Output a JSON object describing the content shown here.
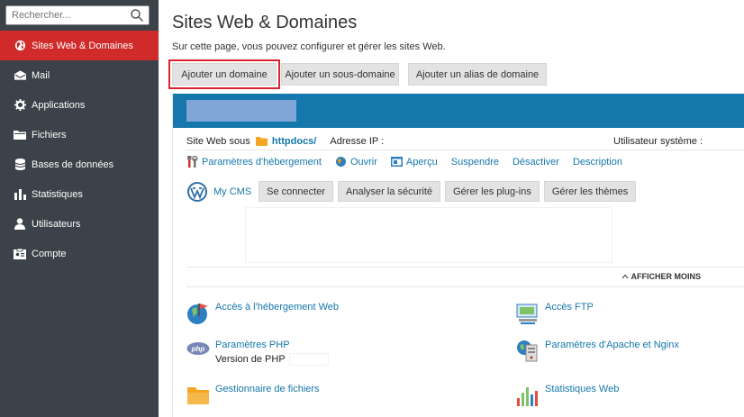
{
  "search": {
    "placeholder": "Rechercher..."
  },
  "sidebar": {
    "items": [
      {
        "label": "Sites Web & Domaines",
        "icon": "globe-icon",
        "active": true
      },
      {
        "label": "Mail",
        "icon": "envelope-icon"
      },
      {
        "label": "Applications",
        "icon": "gear-icon"
      },
      {
        "label": "Fichiers",
        "icon": "folder-icon"
      },
      {
        "label": "Bases de données",
        "icon": "database-icon"
      },
      {
        "label": "Statistiques",
        "icon": "bar-chart-icon"
      },
      {
        "label": "Utilisateurs",
        "icon": "user-icon"
      },
      {
        "label": "Compte",
        "icon": "account-card-icon"
      }
    ]
  },
  "page": {
    "title": "Sites Web & Domaines",
    "description": "Sur cette page, vous pouvez configurer et gérer les sites Web."
  },
  "toolbar": {
    "add_domain": "Ajouter un domaine",
    "add_subdomain": "Ajouter un sous-domaine",
    "add_alias": "Ajouter un alias de domaine"
  },
  "domain": {
    "website_under": "Site Web sous",
    "docroot": "httpdocs/",
    "ip_label": "Adresse IP :",
    "system_user_label": "Utilisateur système :"
  },
  "actions": [
    {
      "label": "Paramètres d'hébergement",
      "icon": "tools-icon"
    },
    {
      "label": "Ouvrir",
      "icon": "open-globe-icon"
    },
    {
      "label": "Aperçu",
      "icon": "preview-icon"
    },
    {
      "label": "Suspendre"
    },
    {
      "label": "Désactiver"
    },
    {
      "label": "Description"
    }
  ],
  "cms": {
    "name": "My CMS",
    "buttons": [
      "Se connecter",
      "Analyser la sécurité",
      "Gérer les plug-ins",
      "Gérer les thèmes"
    ]
  },
  "show_less": "AFFICHER MOINS",
  "tools": {
    "web_hosting": "Accès à l'hébergement Web",
    "ftp": "Accès FTP",
    "php": "Paramètres PHP",
    "php_version": "Version de PHP",
    "apache": "Paramètres d'Apache et Nginx",
    "file_manager": "Gestionnaire de fichiers",
    "web_stats": "Statistiques Web"
  },
  "colors": {
    "sidebar": "#3b4249",
    "active": "#d12a2a",
    "accent": "#1577ab",
    "highlight": "#d9232d"
  }
}
